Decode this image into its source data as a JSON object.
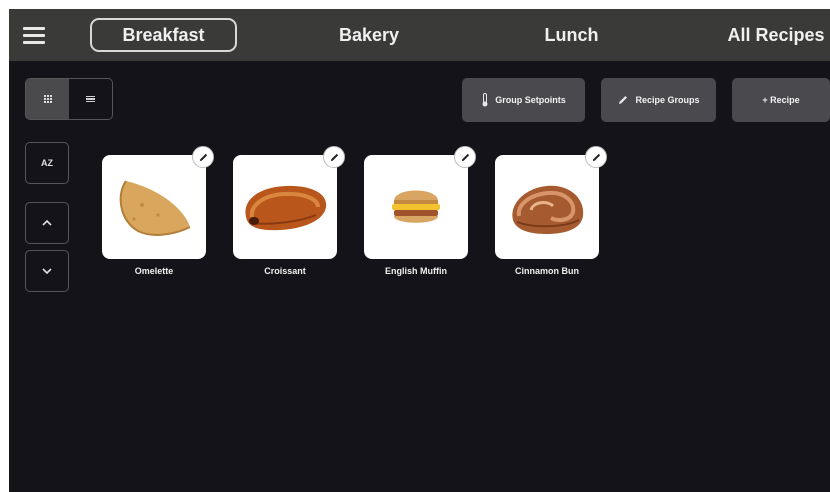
{
  "header": {
    "menu_icon": "hamburger-menu-icon",
    "tabs": [
      {
        "label": "Breakfast",
        "active": true
      },
      {
        "label": "Bakery",
        "active": false
      },
      {
        "label": "Lunch",
        "active": false
      },
      {
        "label": "All Recipes",
        "active": false
      }
    ]
  },
  "toolbar": {
    "view_modes": [
      {
        "icon": "grid-view-icon",
        "active": true
      },
      {
        "icon": "list-view-icon",
        "active": false
      }
    ],
    "group_setpoints_label": "Group Setpoints",
    "recipe_groups_label": "Recipe Groups",
    "add_recipe_label": "+ Recipe"
  },
  "sidebar": {
    "sort_label": "AZ",
    "scroll_up_icon": "chevron-up-icon",
    "scroll_down_icon": "chevron-down-icon"
  },
  "recipes": [
    {
      "name": "Omelette",
      "image": "omelette"
    },
    {
      "name": "Croissant",
      "image": "croissant"
    },
    {
      "name": "English Muffin",
      "image": "english-muffin"
    },
    {
      "name": "Cinnamon Bun",
      "image": "cinnamon-bun"
    }
  ],
  "colors": {
    "background": "#141319",
    "header": "#3a3a39",
    "button": "#4a4a4e",
    "text": "#f0f0f0"
  }
}
